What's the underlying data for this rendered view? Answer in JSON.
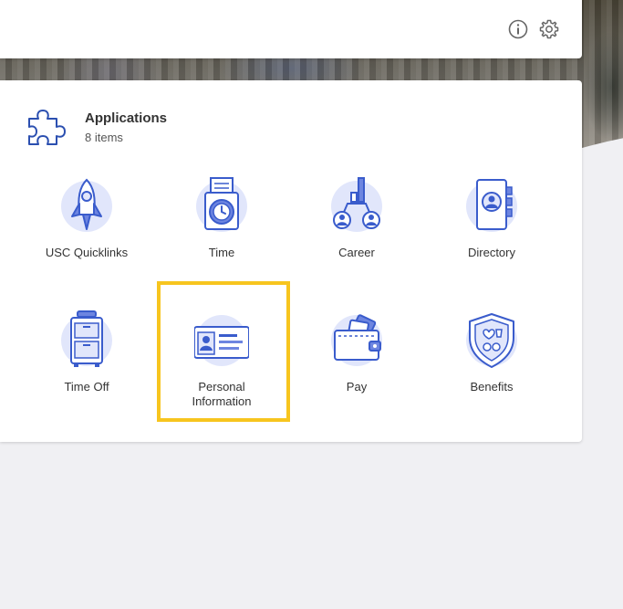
{
  "header": {
    "info_icon": "info-circle-icon",
    "settings_icon": "gear-icon"
  },
  "applications": {
    "title": "Applications",
    "count": "8 items",
    "icon": "puzzle-icon",
    "tiles": [
      {
        "label": "USC Quicklinks",
        "icon": "rocket-icon"
      },
      {
        "label": "Time",
        "icon": "clock-icon"
      },
      {
        "label": "Career",
        "icon": "career-chart-icon"
      },
      {
        "label": "Directory",
        "icon": "address-book-icon"
      },
      {
        "label": "Time Off",
        "icon": "suitcase-icon"
      },
      {
        "label": "Personal\nInformation",
        "icon": "id-card-icon",
        "highlighted": true
      },
      {
        "label": "Pay",
        "icon": "wallet-icon"
      },
      {
        "label": "Benefits",
        "icon": "shield-icon"
      }
    ]
  },
  "colors": {
    "icon_blue": "#3a5ccc",
    "icon_fill": "#e1e6fb",
    "highlight": "#f7c51e"
  }
}
